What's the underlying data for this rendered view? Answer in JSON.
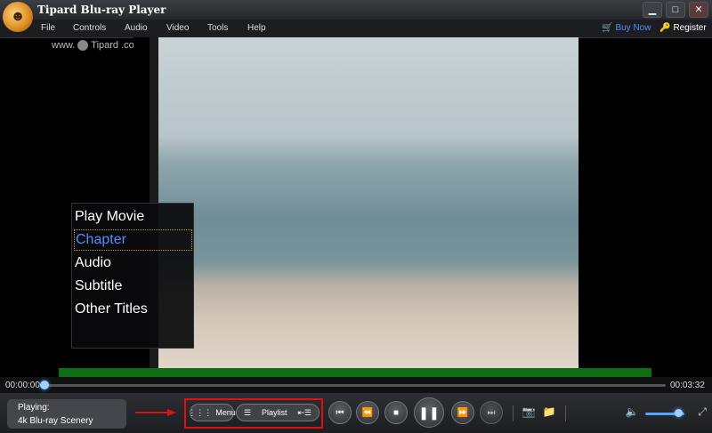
{
  "window": {
    "title": "Tipard Blu-ray Player",
    "buttons": {
      "minimize": "▁",
      "maximize": "□",
      "close": "✕"
    }
  },
  "menu": {
    "items": [
      "File",
      "Controls",
      "Audio",
      "Video",
      "Tools",
      "Help"
    ],
    "buy_now": "Buy Now",
    "register": "Register"
  },
  "watermark": {
    "prefix": "www.",
    "suffix": "Tipard .com"
  },
  "dvd_menu": {
    "options": [
      "Play Movie",
      "Chapter",
      "Audio",
      "Subtitle",
      "Other Titles"
    ],
    "selected": "Chapter"
  },
  "playback": {
    "current_time": "00:00:00",
    "total_time": "00:03:32",
    "progress_fraction": 0.0
  },
  "status": {
    "label": "Playing:",
    "title": "4k Blu-ray Scenery"
  },
  "controls": {
    "menu_label": "Menu",
    "playlist_label": "Playlist",
    "volume_fraction": 0.85
  },
  "colors": {
    "accent": "#4e8fff",
    "highlight_box": "#e01010",
    "selected_border": "#c09a40"
  }
}
